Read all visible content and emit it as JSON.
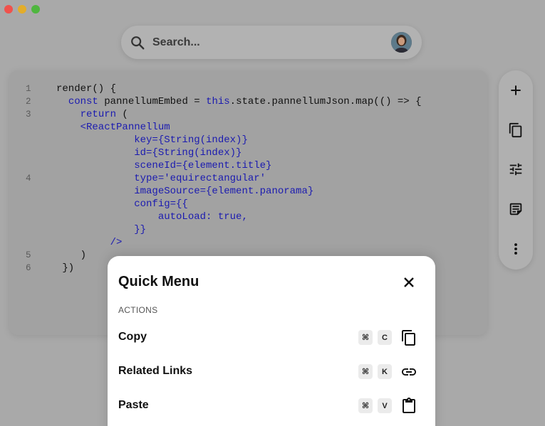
{
  "window": {
    "traffic_lights": {
      "close": "#f0524c",
      "minimize": "#e3ad2a",
      "zoom": "#4fb63f"
    }
  },
  "search": {
    "placeholder": "Search...",
    "icon": "search-icon"
  },
  "code": {
    "lines": [
      {
        "num": "1",
        "parts": [
          {
            "t": "render() {",
            "k": false
          }
        ]
      },
      {
        "num": "2",
        "parts": [
          {
            "t": "  ",
            "k": false
          },
          {
            "t": "const",
            "k": true
          },
          {
            "t": " pannellumEmbed = ",
            "k": false
          },
          {
            "t": "this",
            "k": true
          },
          {
            "t": ".state.pannellumJson.map(() => {",
            "k": false
          }
        ]
      },
      {
        "num": "3",
        "parts": [
          {
            "t": "    ",
            "k": false
          },
          {
            "t": "return",
            "k": true
          },
          {
            "t": " (",
            "k": false
          }
        ]
      },
      {
        "num": "",
        "parts": [
          {
            "t": "    <ReactPannellum",
            "k": true
          }
        ]
      },
      {
        "num": "",
        "parts": [
          {
            "t": "             key={String(index)}",
            "k": true
          }
        ]
      },
      {
        "num": "",
        "parts": [
          {
            "t": "             id={String(index)}",
            "k": true
          }
        ]
      },
      {
        "num": "",
        "parts": [
          {
            "t": "             sceneId={element.title}",
            "k": true
          }
        ]
      },
      {
        "num": "4",
        "parts": [
          {
            "t": "             type='equirectangular'",
            "k": true
          }
        ]
      },
      {
        "num": "",
        "parts": [
          {
            "t": "             imageSource={element.panorama}",
            "k": true
          }
        ]
      },
      {
        "num": "",
        "parts": [
          {
            "t": "             config={{",
            "k": true
          }
        ]
      },
      {
        "num": "",
        "parts": [
          {
            "t": "                 autoLoad: true,",
            "k": true
          }
        ]
      },
      {
        "num": "",
        "parts": [
          {
            "t": "             }}",
            "k": true
          }
        ]
      },
      {
        "num": "",
        "parts": [
          {
            "t": "         />",
            "k": true
          }
        ]
      },
      {
        "num": "5",
        "parts": [
          {
            "t": "    )",
            "k": false
          }
        ]
      },
      {
        "num": "6",
        "parts": [
          {
            "t": " })",
            "k": false
          }
        ]
      }
    ]
  },
  "toolbar": {
    "buttons": [
      {
        "icon": "plus-icon"
      },
      {
        "icon": "copy-icon"
      },
      {
        "icon": "sliders-icon"
      },
      {
        "icon": "note-icon"
      },
      {
        "icon": "more-vertical-icon"
      }
    ]
  },
  "quick_menu": {
    "title": "Quick Menu",
    "section": "ACTIONS",
    "items": [
      {
        "label": "Copy",
        "keys": [
          "⌘",
          "C"
        ],
        "icon": "copy-icon"
      },
      {
        "label": "Related Links",
        "keys": [
          "⌘",
          "K"
        ],
        "icon": "link-icon"
      },
      {
        "label": "Paste",
        "keys": [
          "⌘",
          "V"
        ],
        "icon": "clipboard-icon"
      }
    ]
  }
}
